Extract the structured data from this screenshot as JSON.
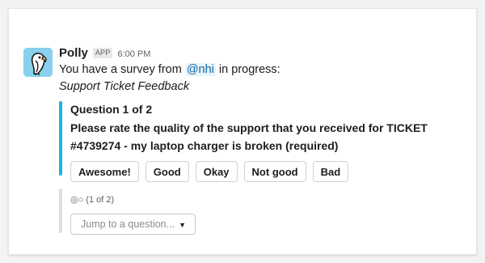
{
  "message": {
    "sender": "Polly",
    "app_badge": "APP",
    "timestamp": "6:00 PM",
    "text_prefix": "You have a survey from ",
    "mention": "@nhi",
    "text_suffix": " in progress:",
    "survey_name": "Support Ticket Feedback"
  },
  "question": {
    "title": "Question 1 of 2",
    "text": "Please rate the quality of the support that you received for TICKET #4739274 - my laptop charger is broken (required)",
    "options": [
      "Awesome!",
      "Good",
      "Okay",
      "Not good",
      "Bad"
    ]
  },
  "progress": {
    "text": "◎○ (1 of 2)"
  },
  "jump": {
    "placeholder": "Jump to a question...",
    "chevron_icon": "chevron-down-icon"
  },
  "colors": {
    "accent_bar": "#1ab2e8",
    "secondary_bar": "#dddddd",
    "mention": "#1264a3",
    "avatar_bg": "#89d0ee"
  }
}
